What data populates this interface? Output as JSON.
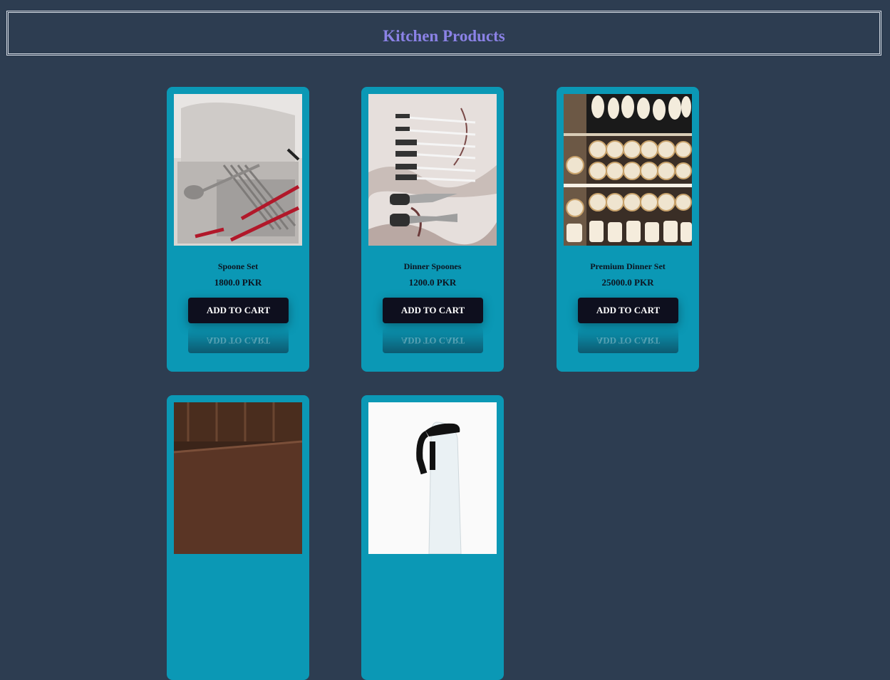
{
  "header": {
    "title": "Kitchen Products"
  },
  "colors": {
    "background": "#2d3d51",
    "title": "#8b82e6",
    "card": "#0b98b5",
    "button": "#0e0f1e"
  },
  "products": [
    {
      "name": "Spoone Set",
      "price": "1800.0 PKR",
      "button_label": "ADD TO CART"
    },
    {
      "name": "Dinner Spoones",
      "price": "1200.0 PKR",
      "button_label": "ADD TO CART"
    },
    {
      "name": "Premium Dinner Set",
      "price": "25000.0 PKR",
      "button_label": "ADD TO CART"
    },
    {
      "name": "",
      "price": "",
      "button_label": ""
    },
    {
      "name": "",
      "price": "",
      "button_label": ""
    }
  ]
}
